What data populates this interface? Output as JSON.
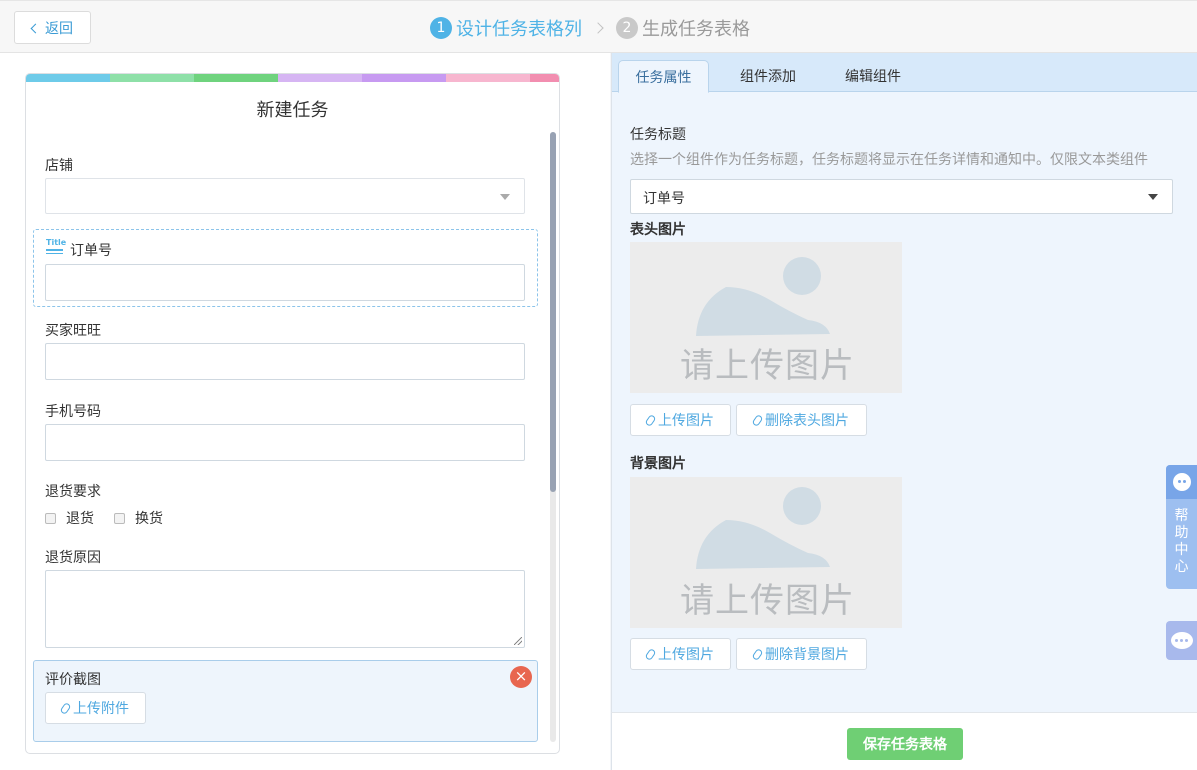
{
  "header": {
    "back_label": "返回",
    "steps": [
      {
        "num": "1",
        "label": "设计任务表格列"
      },
      {
        "num": "2",
        "label": "生成任务表格"
      }
    ]
  },
  "form": {
    "title": "新建任务",
    "strip_colors": [
      "#6ecbe9",
      "#8ee0a8",
      "#6fd37e",
      "#d6b5f3",
      "#c79af1",
      "#f7b6cf",
      "#f28eb0"
    ],
    "fields": {
      "shop_label": "店铺",
      "order_label": "订单号",
      "title_icon_text": "Title",
      "buyer_label": "买家旺旺",
      "phone_label": "手机号码",
      "return_req_label": "退货要求",
      "return_options": [
        "退货",
        "换货"
      ],
      "return_reason_label": "退货原因",
      "review_label": "评价截图",
      "upload_attachment": "上传附件"
    }
  },
  "right": {
    "tabs": [
      "任务属性",
      "组件添加",
      "编辑组件"
    ],
    "task_title_label": "任务标题",
    "task_title_hint": "选择一个组件作为任务标题，任务标题将显示在任务详情和通知中。仅限文本类组件",
    "task_title_value": "订单号",
    "header_image_label": "表头图片",
    "placeholder_text": "请上传图片",
    "upload_image": "上传图片",
    "delete_header_image": "删除表头图片",
    "bg_image_label": "背景图片",
    "delete_bg_image": "删除背景图片"
  },
  "footer": {
    "save_label": "保存任务表格"
  },
  "help": {
    "help_center": "帮助中心"
  },
  "colors": {
    "accent": "#4fb3e6",
    "save_green": "#6fcf74",
    "close_red": "#e8664f"
  }
}
